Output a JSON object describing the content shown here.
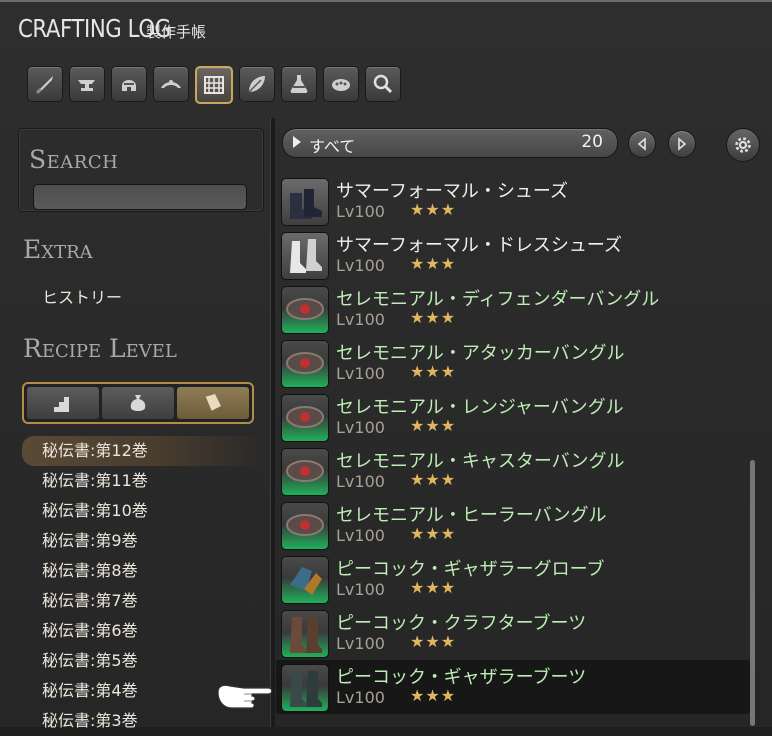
{
  "window": {
    "title": "CRAFTING LOG",
    "subtitle": "製作手帳"
  },
  "categories": [
    {
      "icon": "sword-icon",
      "active": false
    },
    {
      "icon": "anvil-icon",
      "active": false
    },
    {
      "icon": "helmet-icon",
      "active": false
    },
    {
      "icon": "circlet-icon",
      "active": false
    },
    {
      "icon": "loom-icon",
      "active": true
    },
    {
      "icon": "leaf-icon",
      "active": false
    },
    {
      "icon": "flask-icon",
      "active": false
    },
    {
      "icon": "cooking-pot-icon",
      "active": false
    },
    {
      "icon": "magnifier-icon",
      "active": false
    }
  ],
  "search": {
    "label": "Search",
    "value": "",
    "placeholder": ""
  },
  "extra": {
    "label": "Extra",
    "history": "ヒストリー"
  },
  "recipe_level": {
    "label": "Recipe Level",
    "tabs": [
      {
        "icon": "stairs-icon",
        "active": false
      },
      {
        "icon": "bag-icon",
        "active": false
      },
      {
        "icon": "book-icon",
        "active": true
      }
    ],
    "volumes": [
      {
        "label": "秘伝書:第12巻",
        "selected": true
      },
      {
        "label": "秘伝書:第11巻",
        "selected": false
      },
      {
        "label": "秘伝書:第10巻",
        "selected": false
      },
      {
        "label": "秘伝書:第9巻",
        "selected": false
      },
      {
        "label": "秘伝書:第8巻",
        "selected": false
      },
      {
        "label": "秘伝書:第7巻",
        "selected": false
      },
      {
        "label": "秘伝書:第6巻",
        "selected": false
      },
      {
        "label": "秘伝書:第5巻",
        "selected": false
      },
      {
        "label": "秘伝書:第4巻",
        "selected": false
      },
      {
        "label": "秘伝書:第3巻",
        "selected": false
      }
    ]
  },
  "filter": {
    "label": "すべて",
    "count": "20"
  },
  "items": [
    {
      "name": "サマーフォーマル・シューズ",
      "level": "Lv100",
      "stars": "★★★",
      "highlight": false,
      "icon": "shoes-icon",
      "selected": false
    },
    {
      "name": "サマーフォーマル・ドレスシューズ",
      "level": "Lv100",
      "stars": "★★★",
      "highlight": false,
      "icon": "dress-shoes-icon",
      "selected": false
    },
    {
      "name": "セレモニアル・ディフェンダーバングル",
      "level": "Lv100",
      "stars": "★★★",
      "highlight": true,
      "icon": "bangle-icon",
      "selected": false
    },
    {
      "name": "セレモニアル・アタッカーバングル",
      "level": "Lv100",
      "stars": "★★★",
      "highlight": true,
      "icon": "bangle-icon",
      "selected": false
    },
    {
      "name": "セレモニアル・レンジャーバングル",
      "level": "Lv100",
      "stars": "★★★",
      "highlight": true,
      "icon": "bangle-icon",
      "selected": false
    },
    {
      "name": "セレモニアル・キャスターバングル",
      "level": "Lv100",
      "stars": "★★★",
      "highlight": true,
      "icon": "bangle-icon",
      "selected": false
    },
    {
      "name": "セレモニアル・ヒーラーバングル",
      "level": "Lv100",
      "stars": "★★★",
      "highlight": true,
      "icon": "bangle-icon",
      "selected": false
    },
    {
      "name": "ピーコック・ギャザラーグローブ",
      "level": "Lv100",
      "stars": "★★★",
      "highlight": true,
      "icon": "gloves-icon",
      "selected": false
    },
    {
      "name": "ピーコック・クラフターブーツ",
      "level": "Lv100",
      "stars": "★★★",
      "highlight": true,
      "icon": "boots-icon",
      "selected": false
    },
    {
      "name": "ピーコック・ギャザラーブーツ",
      "level": "Lv100",
      "stars": "★★★",
      "highlight": true,
      "icon": "boots-icon",
      "selected": true
    }
  ],
  "colors": {
    "accent_gold": "#c9a760",
    "item_green": "#bdeeb4",
    "star_gold": "#e0b760"
  }
}
